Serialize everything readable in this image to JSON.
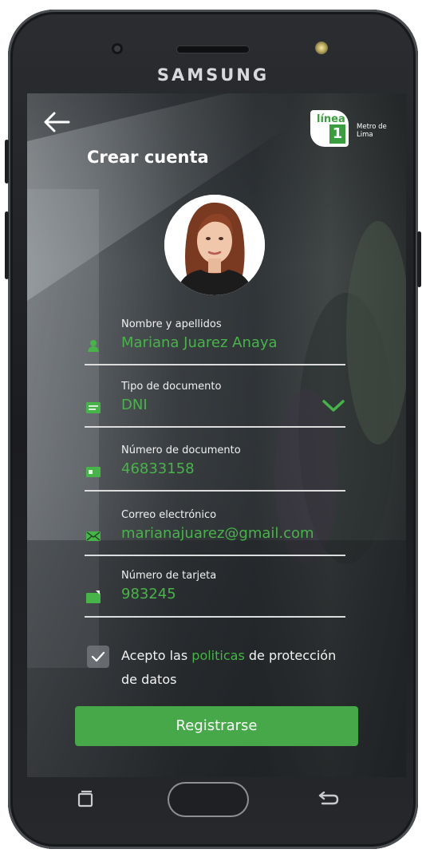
{
  "device": {
    "brand": "SAMSUNG"
  },
  "header": {
    "back_icon": "arrow-left-icon",
    "logo": {
      "linea": "línea",
      "number": "1",
      "metro": "Metro de Lima"
    }
  },
  "page": {
    "title": "Crear cuenta"
  },
  "form": {
    "name": {
      "label": "Nombre y apellidos",
      "value": "Mariana Juarez Anaya",
      "icon": "user-icon"
    },
    "doc_type": {
      "label": "Tipo de documento",
      "value": "DNI",
      "icon": "id-card-icon"
    },
    "doc_number": {
      "label": "Número de documento",
      "value": "46833158",
      "icon": "document-icon"
    },
    "email": {
      "label": "Correo electrónico",
      "value": "marianajuarez@gmail.com",
      "icon": "mail-icon"
    },
    "card": {
      "label": "Número de tarjeta",
      "value": "983245",
      "icon": "card-icon"
    }
  },
  "terms": {
    "checked": true,
    "text_before": "Acepto las ",
    "link": "politicas",
    "text_after": " de protección de datos"
  },
  "submit": {
    "label": "Registrarse"
  },
  "colors": {
    "accent": "#47b449",
    "button": "#47a84a"
  }
}
